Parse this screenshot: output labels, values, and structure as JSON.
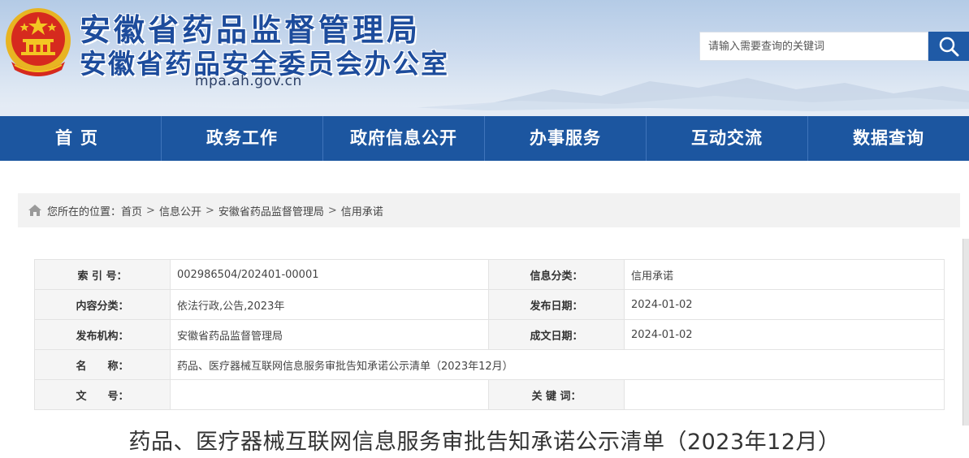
{
  "header": {
    "title_line1": "安徽省药品监督管理局",
    "title_line2": "安徽省药品安全委员会办公室",
    "domain": "mpa.ah.gov.cn",
    "search_placeholder": "请输入需要查询的关键词",
    "emblem_icon": "national-emblem-icon",
    "search_icon": "search-icon"
  },
  "nav": {
    "items": [
      "首页",
      "政务工作",
      "政府信息公开",
      "办事服务",
      "互动交流",
      "数据查询"
    ]
  },
  "breadcrumb": {
    "prefix": "您所在的位置：",
    "items": [
      "首页",
      "信息公开",
      "安徽省药品监督管理局",
      "信用承诺"
    ],
    "separator": ">"
  },
  "info": {
    "index_label": "索 引 号：",
    "index_value": "002986504/202401-00001",
    "category_label": "信息分类：",
    "category_value": "信用承诺",
    "content_type_label": "内容分类：",
    "content_type_value": "依法行政,公告,2023年",
    "publish_date_label": "发布日期：",
    "publish_date_value": "2024-01-02",
    "publisher_label": "发布机构：",
    "publisher_value": "安徽省药品监督管理局",
    "created_date_label": "成文日期：",
    "created_date_value": "2024-01-02",
    "name_label": "名　　称：",
    "name_value": "药品、医疗器械互联网信息服务审批告知承诺公示清单（2023年12月）",
    "doc_no_label": "文　　号：",
    "doc_no_value": "",
    "keywords_label": "关 键 词：",
    "keywords_value": ""
  },
  "article": {
    "title": "药品、医疗器械互联网信息服务审批告知承诺公示清单（2023年12月）"
  },
  "colors": {
    "nav_bg": "#1c56a0",
    "title_blue": "#1d4c9c",
    "search_btn": "#1f5aa6"
  }
}
